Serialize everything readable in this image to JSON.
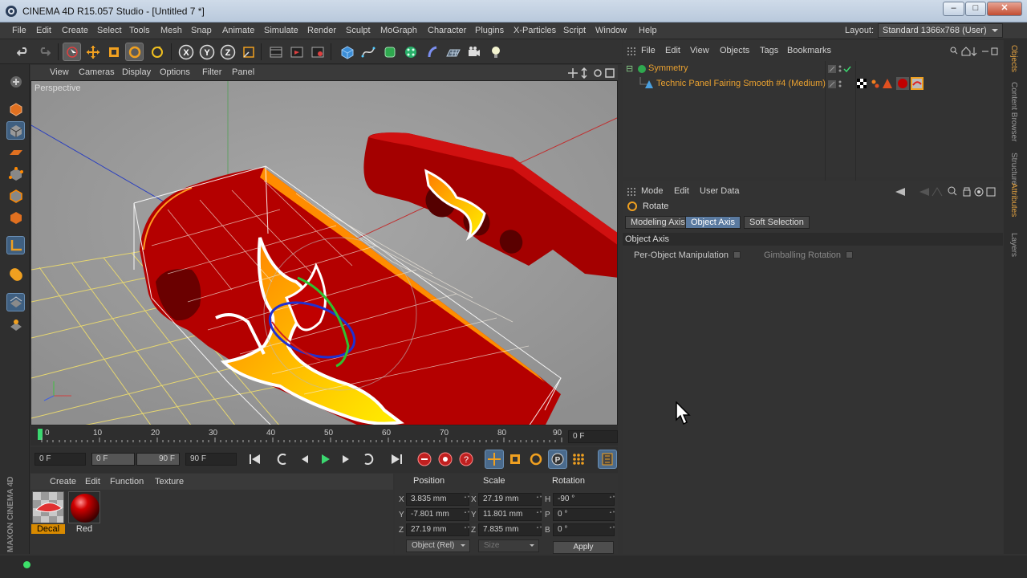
{
  "window": {
    "title": "CINEMA 4D R15.057 Studio - [Untitled 7 *]",
    "min": "–",
    "max": "□",
    "close": "✕"
  },
  "menubar": {
    "items": [
      "File",
      "Edit",
      "Create",
      "Select",
      "Tools",
      "Mesh",
      "Snap",
      "Animate",
      "Simulate",
      "Render",
      "Sculpt",
      "MoGraph",
      "Character",
      "Plugins",
      "X-Particles",
      "Script",
      "Window",
      "Help"
    ],
    "layout_label": "Layout:",
    "layout_value": "Standard 1366x768 (User)"
  },
  "viewport": {
    "menu": [
      "View",
      "Cameras",
      "Display",
      "Options",
      "Filter",
      "Panel"
    ],
    "label": "Perspective",
    "accent_colors": {
      "object_red": "#c00000",
      "highlight_orange": "#ff9a00",
      "cage_yellow": "#e8d070",
      "grid": "#9a9a9a"
    }
  },
  "timeline": {
    "ticks": [
      "0",
      "10",
      "20",
      "30",
      "40",
      "50",
      "60",
      "70",
      "80",
      "90"
    ],
    "current_frame": "0 F"
  },
  "transport": {
    "start_frame": "0 F",
    "range_min": "0 F",
    "range_max": "90 F",
    "end_frame": "90 F"
  },
  "material_manager": {
    "menu": [
      "Create",
      "Edit",
      "Function",
      "Texture"
    ],
    "materials": [
      {
        "name": "Decal",
        "active": true
      },
      {
        "name": "Red",
        "active": false
      }
    ],
    "brand": "MAXON CINEMA 4D"
  },
  "coordinates": {
    "headers": [
      "Position",
      "Scale",
      "Rotation"
    ],
    "position": {
      "x": "3.835 mm",
      "y": "-7.801 mm",
      "z": "27.19 mm"
    },
    "scale": {
      "x": "27.19 mm",
      "y": "11.801 mm",
      "z": "7.835 mm"
    },
    "rotation": {
      "h": "-90 °",
      "p": "0 °",
      "b": "0 °"
    },
    "axis_labels": {
      "x": "X",
      "y": "Y",
      "z": "Z",
      "h": "H",
      "p": "P",
      "b": "B"
    },
    "mode": "Object (Rel)",
    "size": "Size",
    "apply": "Apply"
  },
  "object_manager": {
    "menu": [
      "File",
      "Edit",
      "View",
      "Objects",
      "Tags",
      "Bookmarks"
    ],
    "objects": [
      {
        "name": "Symmetry"
      },
      {
        "name": "Technic Panel Fairing Smooth #4 (Medium)"
      }
    ]
  },
  "attribute_manager": {
    "menu": [
      "Mode",
      "Edit",
      "User Data"
    ],
    "title": "Rotate",
    "tabs": [
      {
        "label": "Modeling Axis",
        "active": false
      },
      {
        "label": "Object Axis",
        "active": true
      },
      {
        "label": "Soft Selection",
        "active": false
      }
    ],
    "section": "Object Axis",
    "options": [
      {
        "label": "Per-Object Manipulation",
        "checked": false
      },
      {
        "label": "Gimballing Rotation",
        "checked": false
      }
    ]
  },
  "side_tabs": [
    "Objects",
    "Content Browser",
    "Structure",
    "Attributes",
    "Layers"
  ]
}
